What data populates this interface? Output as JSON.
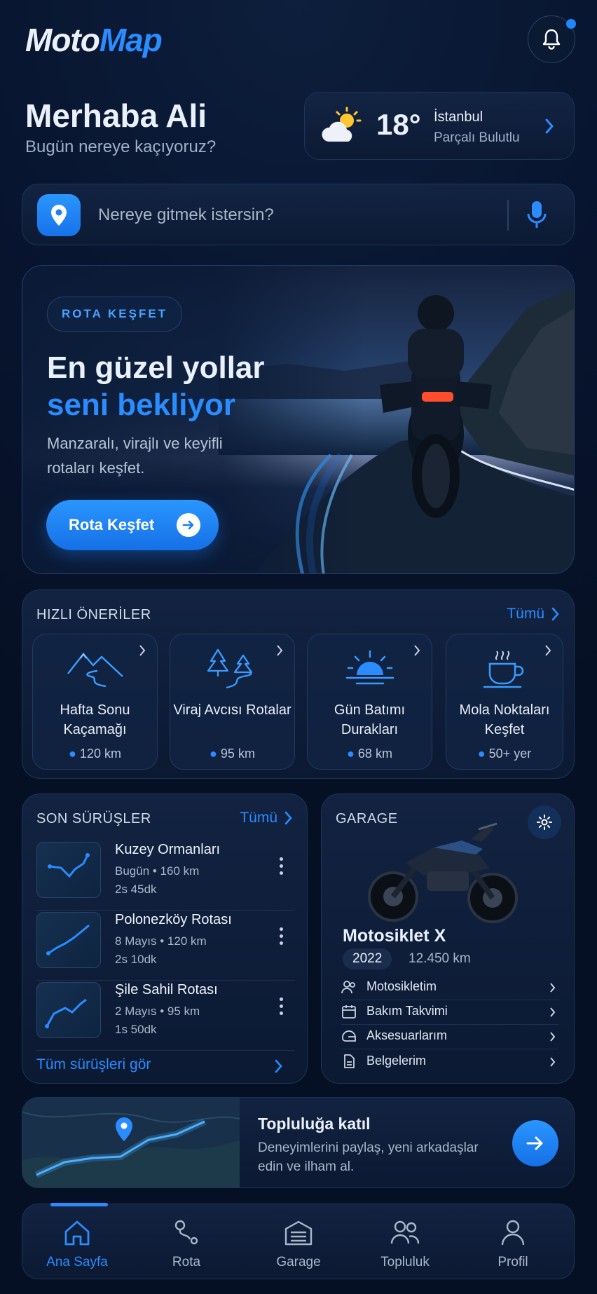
{
  "app": {
    "logo_part1": "Moto",
    "logo_part2": "Map"
  },
  "header": {
    "greeting": "Merhaba Ali",
    "subtitle": "Bugün nereye kaçıyoruz?"
  },
  "weather": {
    "temp": "18°",
    "city": "İstanbul",
    "condition": "Parçalı Bulutlu"
  },
  "search": {
    "placeholder": "Nereye gitmek istersin?"
  },
  "hero": {
    "badge": "ROTA KEŞFET",
    "title_line1": "En güzel yollar",
    "title_line2": "seni bekliyor",
    "description": "Manzaralı, virajlı ve keyifli rotaları keşfet.",
    "cta": "Rota Keşfet"
  },
  "quick": {
    "title": "HIZLI ÖNERİLER",
    "all": "Tümü",
    "items": [
      {
        "label": "Hafta Sonu Kaçamağı",
        "distance": "120 km",
        "icon": "mountain-road-icon"
      },
      {
        "label": "Viraj Avcısı Rotalar",
        "distance": "95 km",
        "icon": "forest-curve-icon"
      },
      {
        "label": "Gün Batımı Durakları",
        "distance": "68 km",
        "icon": "sunset-icon"
      },
      {
        "label": "Mola Noktaları Keşfet",
        "distance": "50+ yer",
        "icon": "coffee-icon"
      }
    ]
  },
  "recent": {
    "title": "SON SÜRÜŞLER",
    "all": "Tümü",
    "rides": [
      {
        "name": "Kuzey Ormanları",
        "meta": "Bugün • 160 km",
        "duration": "2s 45dk"
      },
      {
        "name": "Polonezköy Rotası",
        "meta": "8 Mayıs • 120 km",
        "duration": "2s 10dk"
      },
      {
        "name": "Şile Sahil Rotası",
        "meta": "2 Mayıs • 95 km",
        "duration": "1s 50dk"
      }
    ],
    "see_all": "Tüm sürüşleri gör"
  },
  "garage": {
    "title": "GARAGE",
    "bike_name": "Motosiklet X",
    "year": "2022",
    "mileage": "12.450 km",
    "menu": [
      {
        "label": "Motosikletim",
        "icon": "motorcycle-user-icon"
      },
      {
        "label": "Bakım Takvimi",
        "icon": "calendar-icon"
      },
      {
        "label": "Aksesuarlarım",
        "icon": "helmet-icon"
      },
      {
        "label": "Belgelerim",
        "icon": "document-icon"
      }
    ]
  },
  "community": {
    "title": "Topluluğa katıl",
    "description": "Deneyimlerini paylaş, yeni arkadaşlar edin ve ilham al."
  },
  "nav": {
    "items": [
      {
        "label": "Ana Sayfa",
        "icon": "home-icon",
        "active": true
      },
      {
        "label": "Rota",
        "icon": "route-icon"
      },
      {
        "label": "Garage",
        "icon": "garage-icon"
      },
      {
        "label": "Topluluk",
        "icon": "community-icon"
      },
      {
        "label": "Profil",
        "icon": "profile-icon"
      }
    ]
  },
  "colors": {
    "accent": "#2a8cff",
    "background": "#081530"
  }
}
